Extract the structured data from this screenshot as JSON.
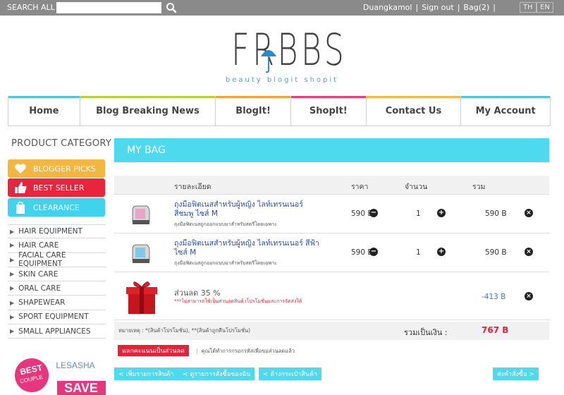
{
  "topbar": {
    "search_label": "SEARCH ALL",
    "search_placeholder": "",
    "user": "Duangkamol",
    "sign_out": "Sign out",
    "bag": "Bag(2)",
    "lang_th": "TH",
    "lang_en": "EN"
  },
  "logo": {
    "wordmark": "FRBBS",
    "tagline": "beauty blogit shopit"
  },
  "nav": [
    {
      "label": "Home",
      "color": "#4fc6e0"
    },
    {
      "label": "Blog Breaking News",
      "color": "#b5d334"
    },
    {
      "label": "BlogIt!",
      "color": "#f2a33a"
    },
    {
      "label": "ShopIt!",
      "color": "#ea3f78"
    },
    {
      "label": "Contact Us",
      "color": "#f5b942"
    },
    {
      "label": "My Account",
      "color": "#4fc6e0"
    }
  ],
  "sidebar": {
    "title": "PRODUCT CATEGORY",
    "pills": [
      {
        "label": "BLOGGER PICKS",
        "color": "#f5b63f",
        "icon": "heart-icon"
      },
      {
        "label": "BEST SELLER",
        "color": "#e9243d",
        "icon": "thumbs-up-icon"
      },
      {
        "label": "CLEARANCE",
        "color": "#3fd3ee",
        "icon": "shopping-bag-icon"
      }
    ],
    "categories": [
      "HAIR EQUIPMENT",
      "HAIR CARE",
      "FACIAL CARE EQUIPMENT",
      "SKIN CARE",
      "ORAL CARE",
      "SHAPEWEAR",
      "SPORT EQUIPMENT",
      "SMALL APPLIANCES"
    ],
    "ad": {
      "badge": "BEST COUPLE",
      "brand": "LESASHA",
      "save": "SAVE"
    }
  },
  "bag": {
    "title": "MY BAG",
    "columns": {
      "detail": "รายละเอียด",
      "price": "ราคา",
      "qty": "จำนวน",
      "total": "รวม"
    },
    "items": [
      {
        "title": "ถุงมือฟิตเนสสำหรับผู้หญิง ไลท์เทรนเนอร์ สีชมพู ไซส์ M",
        "desc": "ถุงมือฟิตเนสถูกออกแบบมาสำหรับสตรีโดยเฉพาะ",
        "price": "590 B",
        "qty": "1",
        "total": "590 B",
        "color": "#e8a5c8"
      },
      {
        "title": "ถุงมือฟิตเนสสำหรับผู้หญิง ไลท์เทรนเนอร์ สีฟ้า ไซส์ M",
        "desc": "ถุงมือฟิตเนสถูกออกแบบมาสำหรับสตรีโดยเฉพาะ",
        "price": "590 B",
        "qty": "1",
        "total": "590 B",
        "color": "#7ec8e8"
      }
    ],
    "discount": {
      "label": "ส่วนลด 35 %",
      "note": "***ไม่สามารถใช้เป็นส่วนลดสินค้าโปรโมชั่นและการจัดส่งได้",
      "amount": "-413 B"
    },
    "summary": {
      "note": "หมายเหตุ : *(สินค้าโปรโมชั่น), **(สินค้าถูกคืนโปรโมชั่น)",
      "total_label": "รวมเป็นเงิน :",
      "total": "767 B"
    },
    "redeem": {
      "button": "แลกคะแนนเป็นส่วนลด",
      "note": "คุณได้ทำการกรอกรหัสเพื่อขอส่วนลดแล้ว"
    },
    "actions": {
      "continue": "< เพิ่มรายการสินค้า",
      "history": "< ดูรายการสั่งซื้อของฉัน",
      "clear": "< ล้างกระเป๋าสินค้า",
      "checkout": "ส่งคำสั่งซื้อ >"
    }
  }
}
